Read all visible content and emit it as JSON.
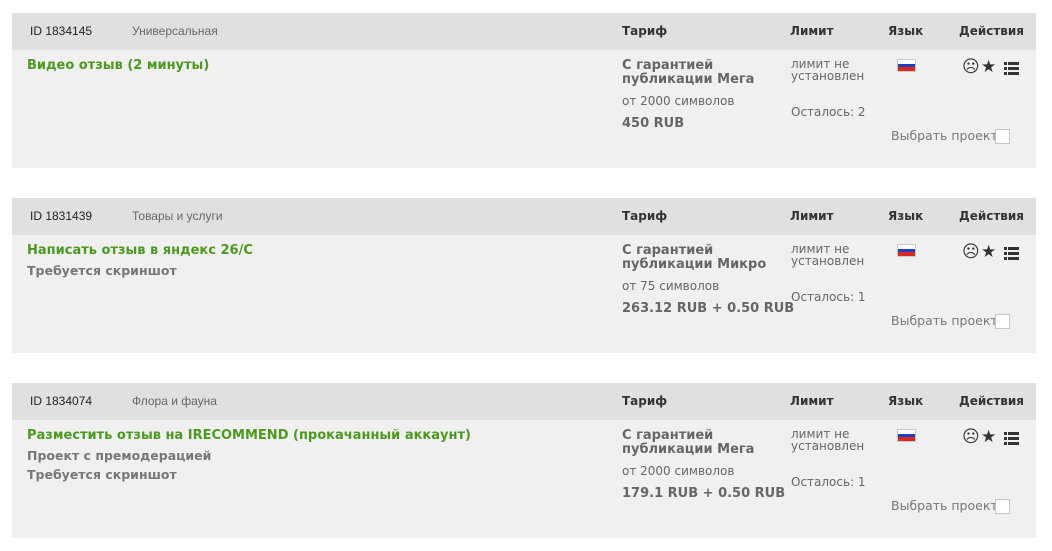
{
  "headers": {
    "tarif": "Тариф",
    "limit": "Лимит",
    "lang": "Язык",
    "actions": "Действия"
  },
  "select_label": "Выбрать проект",
  "limit_text": "лимит не установлен",
  "icons": [
    "sad-face-icon",
    "star-icon",
    "list-icon",
    "russia-flag-icon"
  ],
  "colors": {
    "title_green": "#4a9a1e",
    "header_bg": "#e0e0e0",
    "card_bg": "#f0f0f0"
  },
  "cards": [
    {
      "id": "ID 1834145",
      "category": "Универсальная",
      "title": "Видео отзыв (2 минуты)",
      "notes": [],
      "tariff_name": "С гарантией публикации Мега",
      "tariff_min": "от 2000 символов",
      "price": "450 RUB",
      "remaining": "Осталось: 2"
    },
    {
      "id": "ID 1831439",
      "category": "Товары и услуги",
      "title": "Написать отзыв в яндекс 26/С",
      "notes": [
        "Требуется скриншот"
      ],
      "tariff_name": "С гарантией публикации Микро",
      "tariff_min": "от 75 символов",
      "price": "263.12 RUB + 0.50 RUB",
      "remaining": "Осталось: 1"
    },
    {
      "id": "ID 1834074",
      "category": "Флора и фауна",
      "title": "Разместить отзыв на IRECOMMEND (прокачанный аккаунт)",
      "notes": [
        "Проект с премодерацией",
        "Требуется скриншот"
      ],
      "tariff_name": "С гарантией публикации Мега",
      "tariff_min": "от 2000 символов",
      "price": "179.1 RUB + 0.50 RUB",
      "remaining": "Осталось: 1"
    }
  ]
}
